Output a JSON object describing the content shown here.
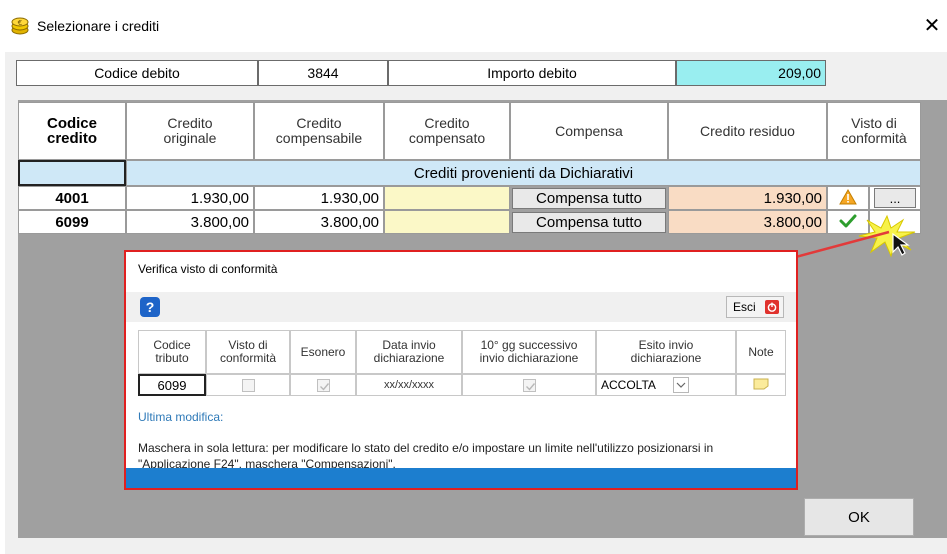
{
  "window": {
    "title": "Selezionare i crediti",
    "close": "✕"
  },
  "debito": {
    "codice_label": "Codice debito",
    "codice_value": "3844",
    "importo_label": "Importo debito",
    "importo_value": "209,00"
  },
  "table": {
    "headers": {
      "codice": "Codice\ncredito",
      "originale": "Credito\noriginale",
      "compensabile": "Credito\ncompensabile",
      "compensato": "Credito\ncompensato",
      "compensa": "Compensa",
      "residuo": "Credito residuo",
      "visto": "Visto di\nconformità"
    },
    "section_label": "Crediti provenienti da Dichiarativi",
    "rows": [
      {
        "codice": "4001",
        "originale": "1.930,00",
        "compensabile": "1.930,00",
        "compensato": "",
        "compensa": "Compensa tutto",
        "residuo": "1.930,00",
        "status": "warning",
        "more": "..."
      },
      {
        "codice": "6099",
        "originale": "3.800,00",
        "compensabile": "3.800,00",
        "compensato": "",
        "compensa": "Compensa tutto",
        "residuo": "3.800,00",
        "status": "ok",
        "more": ""
      }
    ]
  },
  "popup": {
    "title": "Verifica visto di conformità",
    "help": "?",
    "esci": "Esci",
    "headers": {
      "codice": "Codice\ntributo",
      "visto": "Visto di\nconformità",
      "esonero": "Esonero",
      "data": "Data invio\ndichiarazione",
      "gg": "10° gg successivo\ninvio dichiarazione",
      "esito": "Esito invio\ndichiarazione",
      "note": "Note"
    },
    "row": {
      "codice": "6099",
      "data": "xx/xx/xxxx",
      "esito": "ACCOLTA"
    },
    "ultima_modifica": "Ultima modifica:",
    "message": "Maschera in sola lettura: per modificare lo stato del credito e/o impostare un limite nell'utilizzo posizionarsi in \"Applicazione F24\", maschera \"Compensazioni\"."
  },
  "ok_label": "OK",
  "colors": {
    "accent_blue": "#1c7ecf",
    "importo_bg": "#99eef0",
    "section_bg": "#cfe8f7",
    "compensato_bg": "#fbf8c7",
    "residuo_bg": "#f9dcc4",
    "popup_border": "#e02020"
  }
}
